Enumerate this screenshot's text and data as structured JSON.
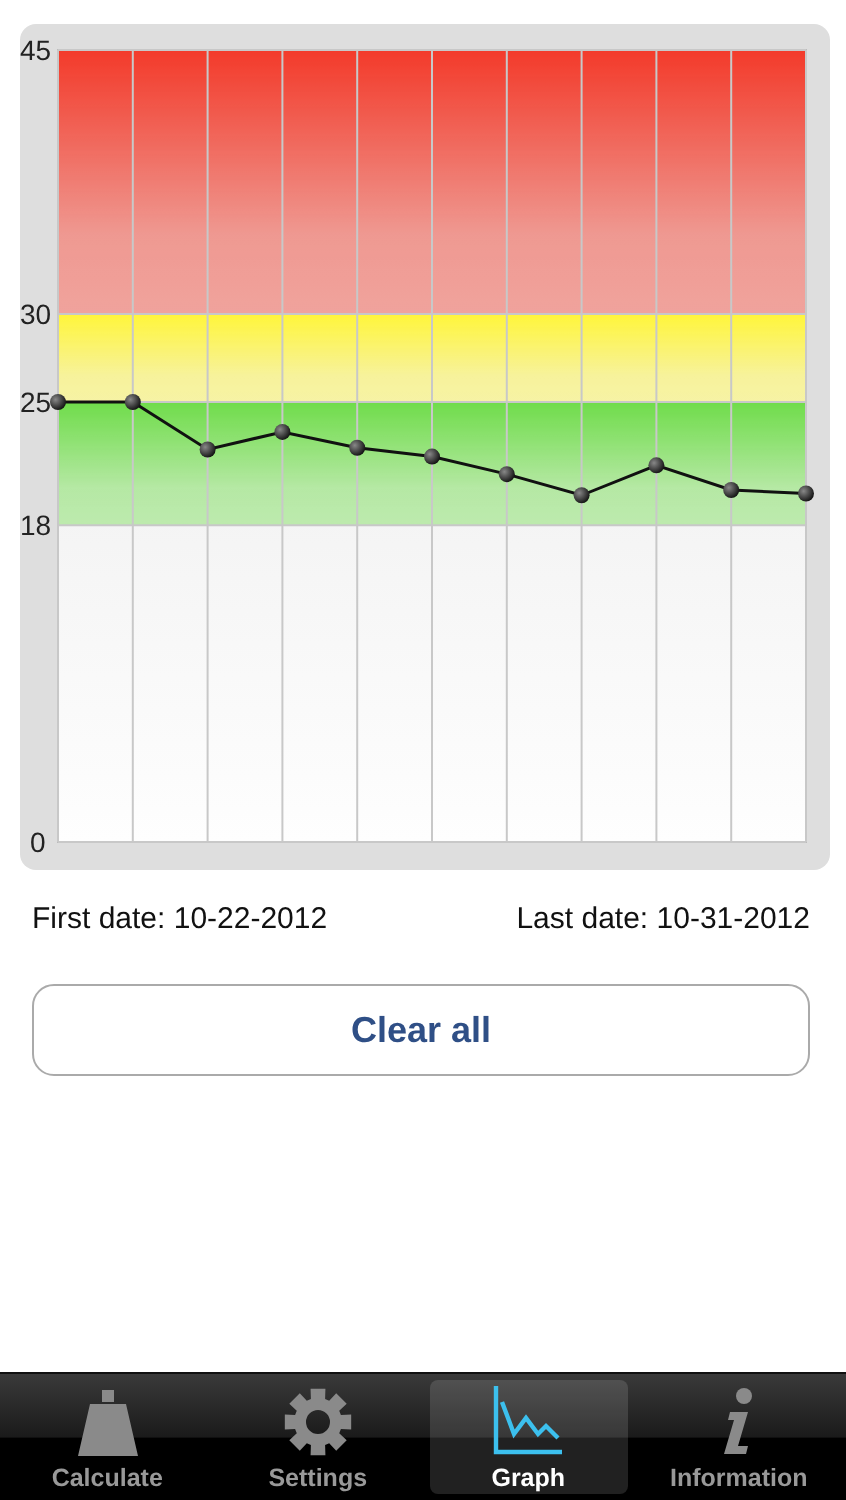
{
  "chart": {
    "chart_data": {
      "type": "line",
      "ylim": [
        0,
        45
      ],
      "yticks": [
        0,
        18,
        25,
        30,
        45
      ],
      "grid": true,
      "series": [
        {
          "color": "#111111",
          "marker": "o",
          "values": [
            25,
            25,
            22.3,
            23.3,
            22.4,
            21.9,
            20.9,
            19.7,
            21.4,
            20,
            19.8
          ]
        }
      ],
      "bands": [
        {
          "axis": "y",
          "from": 30,
          "to": 45,
          "color": "#f33a2a"
        },
        {
          "axis": "y",
          "from": 25,
          "to": 30,
          "color": "#fff53a"
        },
        {
          "axis": "y",
          "from": 18,
          "to": 25,
          "color": "#6fdc4a"
        }
      ]
    }
  },
  "first_date": "First date: 10-22-2012",
  "last_date": "Last date: 10-31-2012",
  "clear_button": "Clear all",
  "tabs": [
    {
      "label": "Calculate",
      "selected": false
    },
    {
      "label": "Settings",
      "selected": false
    },
    {
      "label": "Graph",
      "selected": true
    },
    {
      "label": "Information",
      "selected": false
    }
  ]
}
